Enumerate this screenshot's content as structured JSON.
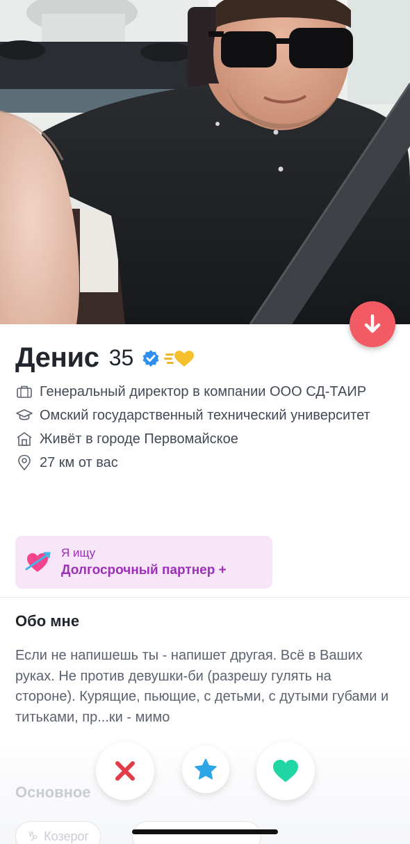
{
  "photo": {
    "description_icon": "profile-photo"
  },
  "profile": {
    "name": "Денис",
    "age": "35",
    "info": [
      {
        "icon": "briefcase-icon",
        "text": "Генеральный директор в компании ООО СД-ТАИР"
      },
      {
        "icon": "graduation-cap-icon",
        "text": "Омский государственный технический университет"
      },
      {
        "icon": "home-icon",
        "text": "Живёт в городе Первомайское"
      },
      {
        "icon": "location-pin-icon",
        "text": "27 км от вас"
      }
    ]
  },
  "looking_for": {
    "label": "Я ищу",
    "value": "Долгосрочный партнер +"
  },
  "about": {
    "title": "Обо мне",
    "text": "Если не напишешь ты - напишет другая. Всё в Ваших руках. Не против девушки-би (разрешу гулять на стороне). Курящие, пьющие, с детьми, с дутыми губами и титьками, пр...ки - мимо"
  },
  "basics": {
    "title": "Основное",
    "chips": [
      "Козерог",
      ""
    ]
  },
  "colors": {
    "accent": "#f25b63",
    "looking_bg": "#f6e6f7",
    "looking_text": "#9d2fb8",
    "nope": "#e23b4a",
    "super": "#2ea6e6",
    "like": "#1fd6a4"
  }
}
